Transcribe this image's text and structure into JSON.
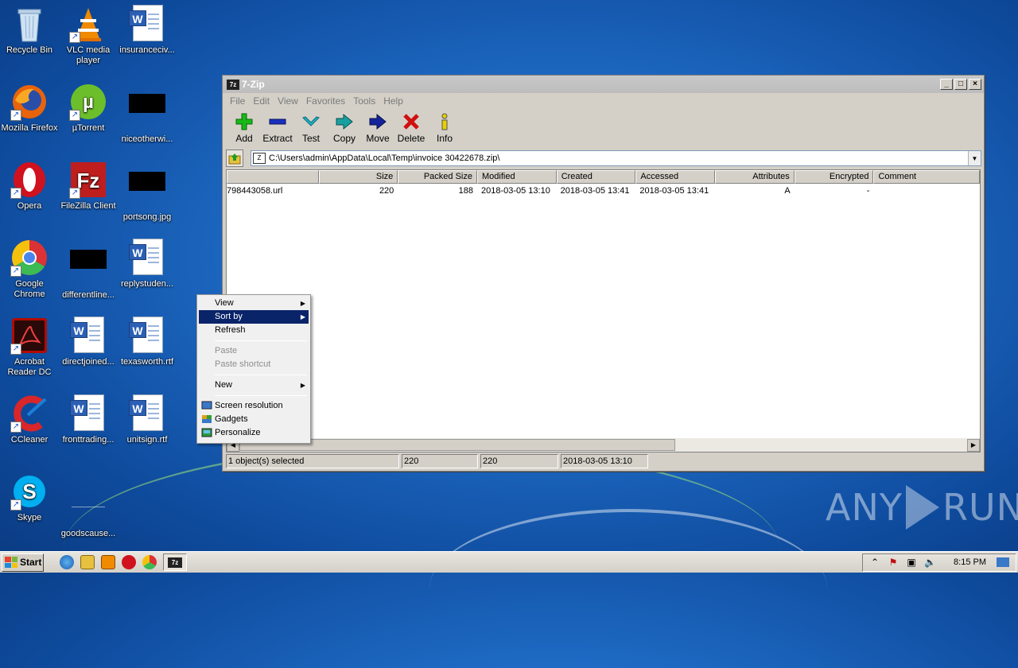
{
  "desktop": {
    "icons": [
      {
        "label": "Recycle Bin"
      },
      {
        "label": "VLC media player"
      },
      {
        "label": "insuranceciv..."
      },
      {
        "label": "Mozilla Firefox"
      },
      {
        "label": "µTorrent"
      },
      {
        "label": "niceotherwi..."
      },
      {
        "label": "Opera"
      },
      {
        "label": "FileZilla Client"
      },
      {
        "label": "portsong.jpg"
      },
      {
        "label": "Google Chrome"
      },
      {
        "label": "differentline..."
      },
      {
        "label": "replystuden..."
      },
      {
        "label": "Acrobat Reader DC"
      },
      {
        "label": "directjoined..."
      },
      {
        "label": "texasworth.rtf"
      },
      {
        "label": "CCleaner"
      },
      {
        "label": "fronttrading..."
      },
      {
        "label": "unitsign.rtf"
      },
      {
        "label": "Skype"
      },
      {
        "label": "goodscause..."
      }
    ]
  },
  "window": {
    "title": "7-Zip",
    "app_icon_text": "7z",
    "menu": [
      "File",
      "Edit",
      "View",
      "Favorites",
      "Tools",
      "Help"
    ],
    "toolbar": [
      {
        "label": "Add",
        "icon": "plus-icon",
        "color": "#18b818"
      },
      {
        "label": "Extract",
        "icon": "minus-icon",
        "color": "#1a2fbf"
      },
      {
        "label": "Test",
        "icon": "check-icon",
        "color": "#22b8c8"
      },
      {
        "label": "Copy",
        "icon": "copy-arrow-icon",
        "color": "#18a0a0"
      },
      {
        "label": "Move",
        "icon": "move-arrow-icon",
        "color": "#14239a"
      },
      {
        "label": "Delete",
        "icon": "x-icon",
        "color": "#d01010"
      },
      {
        "label": "Info",
        "icon": "info-icon",
        "color": "#c8b000"
      }
    ],
    "address": "C:\\Users\\admin\\AppData\\Local\\Temp\\invoice 30422678.zip\\",
    "columns": [
      "",
      "Size",
      "Packed Size",
      "Modified",
      "Created",
      "Accessed",
      "Attributes",
      "Encrypted",
      "Comment"
    ],
    "rows": [
      {
        "name": "798443058.url",
        "size": "220",
        "packed": "188",
        "modified": "2018-03-05 13:10",
        "created": "2018-03-05 13:41",
        "accessed": "2018-03-05 13:41",
        "attributes": "A",
        "encrypted": "-",
        "comment": ""
      }
    ],
    "status": {
      "selected": "1 object(s) selected",
      "size": "220",
      "packed": "220",
      "modified": "2018-03-05 13:10"
    }
  },
  "context_menu": {
    "items": [
      {
        "label": "View",
        "submenu": true
      },
      {
        "label": "Sort by",
        "submenu": true,
        "highlighted": true
      },
      {
        "label": "Refresh"
      },
      {
        "label": "Paste",
        "disabled": true
      },
      {
        "label": "Paste shortcut",
        "disabled": true
      },
      {
        "label": "New",
        "submenu": true
      },
      {
        "label": "Screen resolution"
      },
      {
        "label": "Gadgets"
      },
      {
        "label": "Personalize"
      }
    ]
  },
  "watermark": {
    "left": "ANY",
    "right": "RUN"
  },
  "taskbar": {
    "start_label": "Start",
    "clock": "8:15 PM",
    "task_7zip_icon": "7z"
  }
}
